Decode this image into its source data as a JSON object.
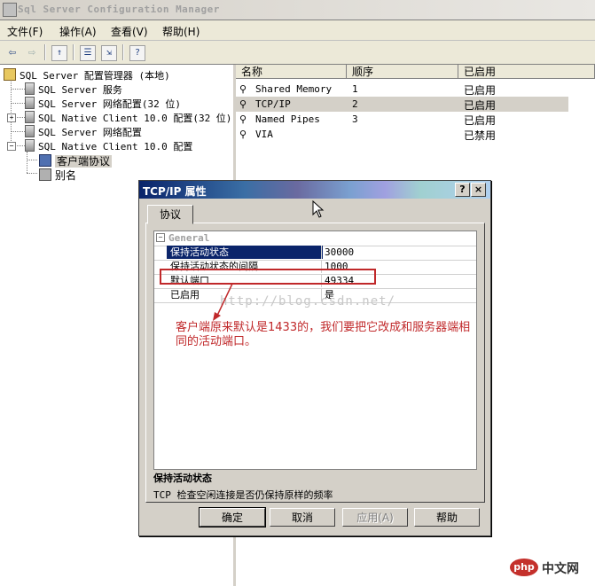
{
  "window": {
    "title": "Sql Server Configuration Manager"
  },
  "menu": [
    "文件(F)",
    "操作(A)",
    "查看(V)",
    "帮助(H)"
  ],
  "tree": {
    "root": "SQL Server 配置管理器 (本地)",
    "items": [
      "SQL Server 服务",
      "SQL Server 网络配置(32 位)",
      "SQL Native Client 10.0 配置(32 位)",
      "SQL Server 网络配置",
      "SQL Native Client 10.0 配置"
    ],
    "children": [
      "客户端协议",
      "别名"
    ]
  },
  "list": {
    "columns": [
      "名称",
      "顺序",
      "已启用"
    ],
    "rows": [
      {
        "name": "Shared Memory",
        "order": "1",
        "enabled": "已启用"
      },
      {
        "name": "TCP/IP",
        "order": "2",
        "enabled": "已启用"
      },
      {
        "name": "Named Pipes",
        "order": "3",
        "enabled": "已启用"
      },
      {
        "name": "VIA",
        "order": "",
        "enabled": "已禁用"
      }
    ]
  },
  "dialog": {
    "title": "TCP/IP 属性",
    "help_button": "?",
    "close_button": "×",
    "tab": "协议",
    "category": "General",
    "properties": [
      {
        "name": "保持活动状态",
        "value": "30000"
      },
      {
        "name": "保持活动状态的间隔",
        "value": "1000"
      },
      {
        "name": "默认端口",
        "value": "49334"
      },
      {
        "name": "已启用",
        "value": "是"
      }
    ],
    "description_title": "保持活动状态",
    "description_text": "TCP 检查空闲连接是否仍保持原样的频率",
    "buttons": {
      "ok": "确定",
      "cancel": "取消",
      "apply": "应用(A)",
      "help": "帮助"
    }
  },
  "annotation": {
    "watermark": "http://blog.csdn.net/",
    "note": "客户端原来默认是1433的，我们要把它改成和服务器端相同的活动端口。"
  },
  "logo": {
    "badge": "php",
    "text": "中文网"
  },
  "colors": {
    "annotation": "#c0282a",
    "selection": "#0a246a"
  }
}
